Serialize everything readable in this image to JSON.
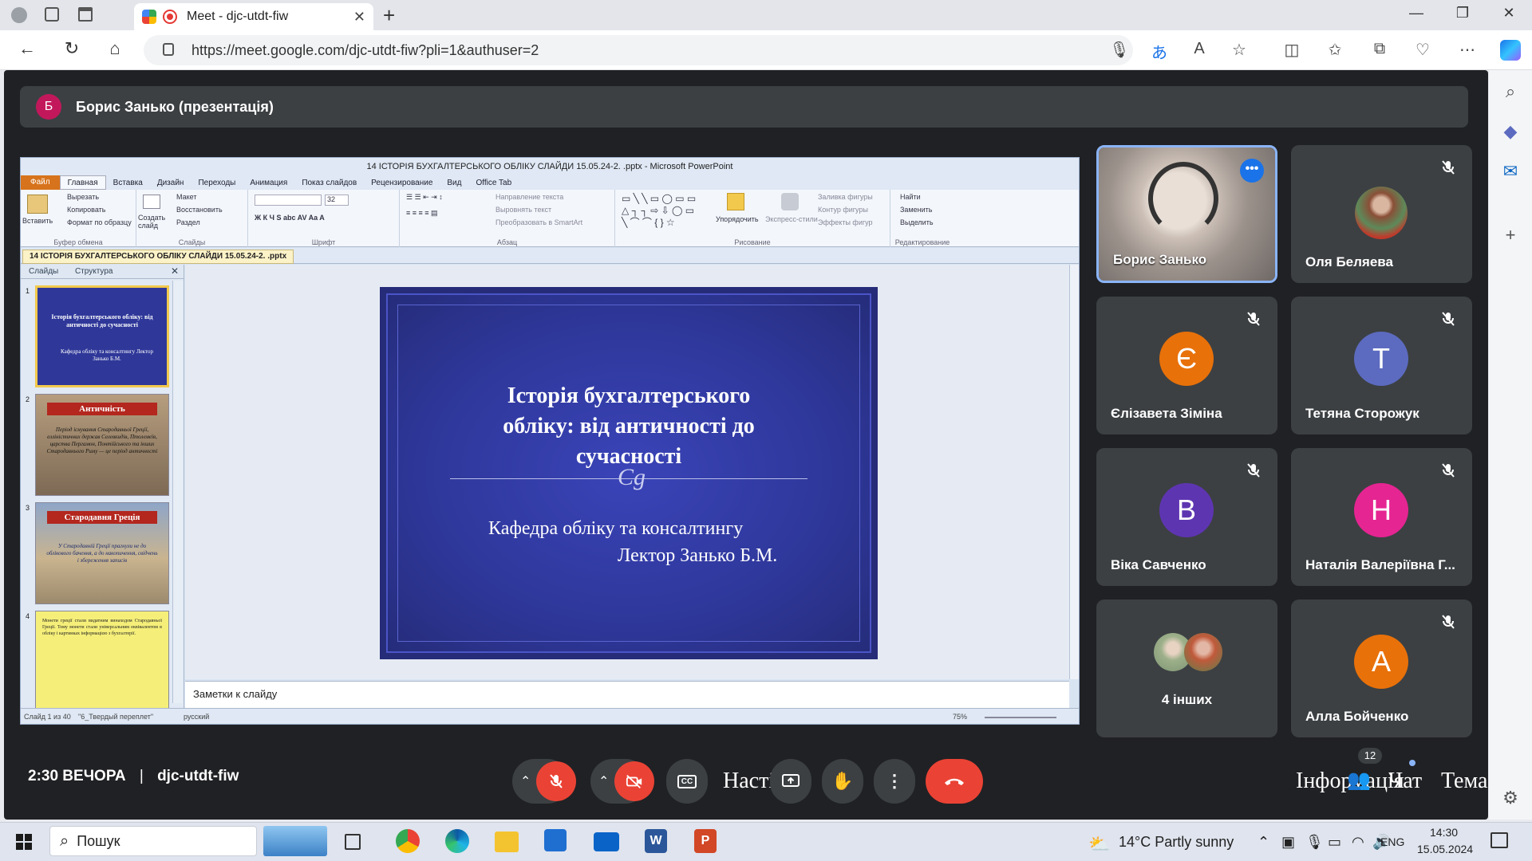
{
  "browser": {
    "tab_title": "Meet - djc-utdt-fiw",
    "new_tab": "+",
    "url": "https://meet.google.com/djc-utdt-fiw?pli=1&authuser=2",
    "window_min": "—",
    "window_max": "❐",
    "window_close": "✕"
  },
  "presenter": {
    "initial": "Б",
    "label": "Борис Занько (презентація)"
  },
  "powerpoint": {
    "window_title": "14 ІСТОРІЯ БУХГАЛТЕРСЬКОГО ОБЛІКУ СЛАЙДИ 15.05.24-2. .pptx - Microsoft PowerPoint",
    "menu": [
      "Файл",
      "Главная",
      "Вставка",
      "Дизайн",
      "Переходы",
      "Анимация",
      "Показ слайдов",
      "Рецензирование",
      "Вид",
      "Office Tab"
    ],
    "ribbon": {
      "clipboard": {
        "label": "Буфер обмена",
        "paste": "Вставить",
        "cut": "Вырезать",
        "copy": "Копировать",
        "format": "Формат по образцу"
      },
      "slides": {
        "label": "Слайды",
        "new": "Создать слайд",
        "layout": "Макет",
        "reset": "Восстановить",
        "section": "Раздел"
      },
      "font": {
        "label": "Шрифт",
        "size": "32"
      },
      "paragraph": {
        "label": "Абзац",
        "direction": "Направление текста",
        "align": "Выровнять текст",
        "smartart": "Преобразовать в SmartArt"
      },
      "drawing": {
        "label": "Рисование",
        "arrange": "Упорядочить",
        "styles": "Экспресс-стили",
        "fill": "Заливка фигуры",
        "outline": "Контур фигуры",
        "effects": "Эффекты фигур"
      },
      "editing": {
        "label": "Редактирование",
        "find": "Найти",
        "replace": "Заменить",
        "select": "Выделить"
      }
    },
    "doc_tab": "14 ІСТОРІЯ БУХГАЛТЕРСЬКОГО ОБЛІКУ СЛАЙДИ 15.05.24-2. .pptx",
    "pane_tabs": [
      "Слайды",
      "Структура"
    ],
    "thumbnails": [
      {
        "num": "1",
        "title": "Історія бухгалтерського обліку: від античності до сучасності",
        "sub": "Кафедра обліку та консалтингу Лектор Занько Б.М."
      },
      {
        "num": "2",
        "title": "Античність",
        "sub": "Період існування Стародавньої Греції, елліністичних держав Селевкидів, Птолемеїв, царства Пергамон, Понтійського та інших Стародавнього Риму — це період античності"
      },
      {
        "num": "3",
        "title": "Стародавня Греція",
        "sub": "У Стародавній Греції прагнули не до облікового бачення, а до накопичення, свідчень і збереження записів"
      },
      {
        "num": "4",
        "title": "",
        "sub": "Монети греції стали видатним винаходом Стародавньої Греції. Тому монети стали універсальним еквівалентом в обліку і картинках інформацією з бухгалтерії."
      }
    ],
    "slide": {
      "title": "Історія бухгалтерського обліку: від античності до сучасності",
      "ornament": "Cg",
      "subtitle_1": "Кафедра обліку та консалтингу",
      "subtitle_2": "Лектор Занько Б.М."
    },
    "notes_placeholder": "Заметки к слайду",
    "status": {
      "slide": "Слайд 1 из 40",
      "theme": "\"6_Твердый переплет\"",
      "lang": "русский",
      "zoom": "75%"
    }
  },
  "participants": [
    {
      "name": "Борис Занько",
      "type": "video",
      "active": true
    },
    {
      "name": "Оля Беляева",
      "type": "photo"
    },
    {
      "name": "Єлізавета Зіміна",
      "initial": "Є",
      "color": "#e8710a"
    },
    {
      "name": "Тетяна Сторожук",
      "initial": "Т",
      "color": "#5c6bc0"
    },
    {
      "name": "Віка Савченко",
      "initial": "В",
      "color": "#5e35b1"
    },
    {
      "name": "Наталія Валеріївна Г...",
      "initial": "Н",
      "color": "#e52592"
    },
    {
      "name": "4 інших",
      "type": "others"
    },
    {
      "name": "Алла Бойченко",
      "initial": "А",
      "color": "#e8710a"
    }
  ],
  "meeting": {
    "time": "2:30 ВЕЧОРА",
    "code": "djc-utdt-fiw",
    "overlap_left": "Насті",
    "info_label": "Інформація",
    "chat_label": "Чат",
    "theme_label": "Тема",
    "participants_badge": "12"
  },
  "taskbar": {
    "search": "Пошук",
    "weather": "14°C  Partly sunny",
    "lang": "ENG",
    "time": "14:30",
    "date": "15.05.2024"
  },
  "colors": {
    "meet_bg": "#202124",
    "tile_bg": "#3c4043",
    "end_call": "#ea4335",
    "slide_blue": "#2e3799"
  }
}
